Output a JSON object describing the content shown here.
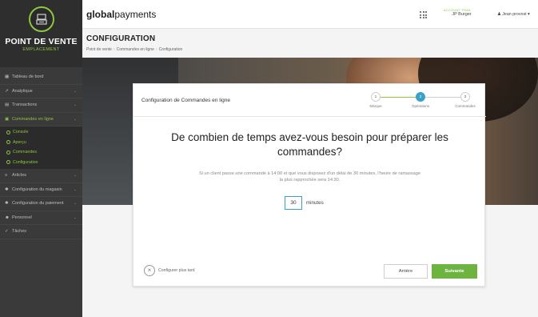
{
  "sidebar": {
    "logo_title": "POINT DE VENTE",
    "logo_subtitle": "EMPLACEMENT",
    "items": [
      {
        "label": "Tableau de bord",
        "icon": "dashboard-icon"
      },
      {
        "label": "Analytique",
        "icon": "chart-icon"
      },
      {
        "label": "Transactions",
        "icon": "transactions-icon"
      },
      {
        "label": "Commandes en ligne",
        "icon": "cart-icon"
      }
    ],
    "subitems": [
      "Console",
      "Aperçu",
      "Commandes",
      "Configuration"
    ],
    "items_after": [
      {
        "label": "Articles",
        "icon": "articles-icon"
      },
      {
        "label": "Configuration du magasin",
        "icon": "gear-icon"
      },
      {
        "label": "Configuration du paiement",
        "icon": "gear-icon"
      },
      {
        "label": "Personnel",
        "icon": "users-icon"
      },
      {
        "label": "Tâches",
        "icon": "tasks-icon"
      }
    ]
  },
  "header": {
    "brand_bold": "global",
    "brand_regular": "payments",
    "account_label": "ACCOUNT TRAIL",
    "account_name": "JP Burger",
    "user_name": "Jean provost"
  },
  "page": {
    "title": "CONFIGURATION",
    "breadcrumb": [
      "Point de vente",
      "Commandes en ligne",
      "Configuration"
    ]
  },
  "card": {
    "title": "Configuration de Commandes en ligne",
    "steps": [
      {
        "number": "1",
        "label": "Marque"
      },
      {
        "number": "2",
        "label": "Opérations"
      },
      {
        "number": "3",
        "label": "Commandes"
      }
    ],
    "active_step": 2,
    "question": "De combien de temps avez-vous besoin pour préparer les commandes?",
    "hint": "Si un client passe une commande à 14:00 et que vous disposez d'un délai de 30 minutes, l'heure de ramassage la plus rapprochée sera 14:30.",
    "minutes_value": "30",
    "minutes_unit": "minutes",
    "later_label": "Configurer plus tard",
    "back_label": "Arrière",
    "next_label": "Suivante"
  },
  "colors": {
    "accent_green": "#8dc63f",
    "step_blue": "#3aa0c8",
    "button_green": "#6cb33f"
  }
}
